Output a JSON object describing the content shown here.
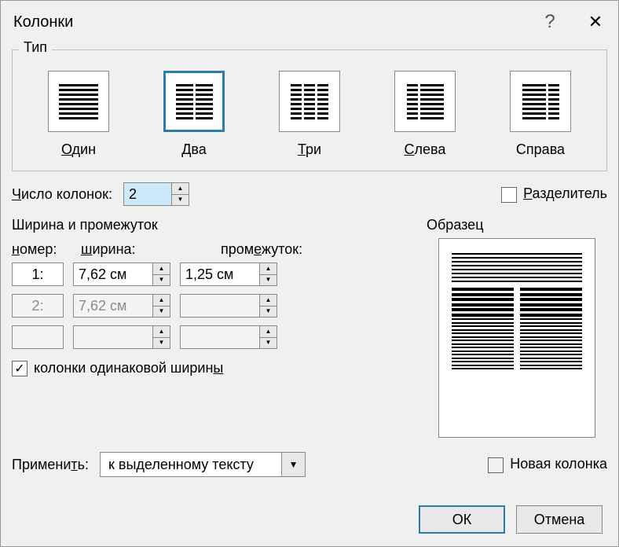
{
  "title": "Колонки",
  "group_type": "Тип",
  "types": [
    {
      "label": "Один",
      "u": "О",
      "rest": "дин"
    },
    {
      "label": "Два",
      "u": "Д",
      "rest": "ва"
    },
    {
      "label": "Три",
      "u": "Т",
      "rest": "ри"
    },
    {
      "label": "Слева",
      "u": "С",
      "rest": "лева"
    },
    {
      "label": "Справа",
      "u": "",
      "rest": "Справа"
    }
  ],
  "count_label_pre": "Ч",
  "count_label_rest": "исло колонок:",
  "count_value": "2",
  "divider_label_pre": "Р",
  "divider_label_rest": "азделитель",
  "wp_title": "Ширина и промежуток",
  "h_number_pre": "н",
  "h_number_rest": "омер:",
  "h_width_pre": "ш",
  "h_width_rest": "ирина:",
  "h_gap_pre": "пром",
  "h_gap_u": "е",
  "h_gap_rest": "жуток:",
  "rows": [
    {
      "n": "1:",
      "w": "7,62 см",
      "g": "1,25 см",
      "dis": false
    },
    {
      "n": "2:",
      "w": "7,62 см",
      "g": "",
      "dis": true
    },
    {
      "n": "",
      "w": "",
      "g": "",
      "dis": true
    }
  ],
  "equal_label_pre": "колонки одинаковой ширин",
  "equal_label_u": "ы",
  "sample_label": "Образец",
  "apply_label_pre": "Примени",
  "apply_label_u": "т",
  "apply_label_rest": "ь:",
  "apply_value": "к выделенному тексту",
  "newcol_label": "Новая колонка",
  "ok": "ОК",
  "cancel": "Отмена"
}
